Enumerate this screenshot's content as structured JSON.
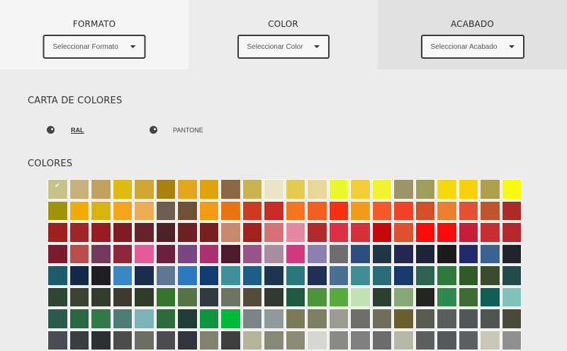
{
  "filters": [
    {
      "title": "FORMATO",
      "placeholder": "Seleccionar Formato"
    },
    {
      "title": "COLOR",
      "placeholder": "Seleccionar Color"
    },
    {
      "title": "ACABADO",
      "placeholder": "Seleccionar Acabado"
    }
  ],
  "color_chart": {
    "title": "CARTA DE COLORES",
    "options": [
      {
        "label": "RAL",
        "icon": "palette-icon",
        "selected": true
      },
      {
        "label": "PANTONE",
        "icon": "palette-icon",
        "selected": false
      }
    ]
  },
  "colors_section": {
    "title": "COLORES",
    "selected_index": 0,
    "swatches": [
      "#c7c18a",
      "#c8b07a",
      "#c4a060",
      "#e0b812",
      "#d2a635",
      "#a9820f",
      "#e4a51a",
      "#dea20c",
      "#8c6847",
      "#cbb553",
      "#eae5c7",
      "#e5ca50",
      "#e7d89a",
      "#ecf82a",
      "#f2cf38",
      "#f2f330",
      "#9e9568",
      "#9e9e5a",
      "#f5d90c",
      "#f8d009",
      "#aea04c",
      "#f8f90c",
      "#a19209",
      "#f2ac06",
      "#dbb30e",
      "#f5a41c",
      "#efaa55",
      "#6e5e52",
      "#6f5233",
      "#f39c12",
      "#ed7312",
      "#cc3a22",
      "#c92a26",
      "#f9731e",
      "#f35f21",
      "#fb2e11",
      "#f39c1a",
      "#f7572b",
      "#f24127",
      "#d44e28",
      "#ee7f2e",
      "#e65136",
      "#c2552f",
      "#ad2b27",
      "#a01f1f",
      "#a22527",
      "#9a1b1f",
      "#7f1c26",
      "#65232a",
      "#4e2226",
      "#6e2025",
      "#7a1e20",
      "#c58a6e",
      "#a2231d",
      "#d47278",
      "#e38aa0",
      "#b32a2d",
      "#de3042",
      "#d6303c",
      "#c7090d",
      "#de512f",
      "#fb0a0a",
      "#fc0a0a",
      "#c71e3c",
      "#ca2e33",
      "#b6262d",
      "#7b1c30",
      "#b84e49",
      "#74385c",
      "#8c283a",
      "#e45b9a",
      "#6d1f3f",
      "#7a4784",
      "#aa3271",
      "#4e1a2d",
      "#98558a",
      "#a88c9f",
      "#d23a80",
      "#8f7fb0",
      "#6f6d70",
      "#2e4e80",
      "#233643",
      "#232751",
      "#1f2536",
      "#1b1b1c",
      "#232b6e",
      "#3b6295",
      "#22242c",
      "#1e5c6c",
      "#15294a",
      "#211d25",
      "#3b86c1",
      "#1b2b4e",
      "#5e7893",
      "#2b7ac0",
      "#123b70",
      "#41909a",
      "#1c5e88",
      "#1e3652",
      "#28787c",
      "#1f2f55",
      "#4a6f95",
      "#3f8f94",
      "#296b76",
      "#163a69",
      "#2d6450",
      "#2c7a3c",
      "#305b29",
      "#3d4c2c",
      "#234b4e",
      "#2e4634",
      "#3e4434",
      "#333d2e",
      "#3d3b31",
      "#2f3a2b",
      "#33752c",
      "#557547",
      "#323b3f",
      "#6c7462",
      "#554d3a",
      "#333833",
      "#1f5a43",
      "#4c953c",
      "#55ac3b",
      "#bfe3b1",
      "#2d4130",
      "#86a877",
      "#262421",
      "#2d8b4e",
      "#3e6d31",
      "#0f5f56",
      "#7fc3bb",
      "#2c5a4b",
      "#286741",
      "#307a45",
      "#4d7e76",
      "#7cb3ba",
      "#2b6c39",
      "#203c36",
      "#0f933e",
      "#00b837",
      "#7b8589",
      "#8f989b",
      "#7d7a57",
      "#7c8166",
      "#9b9b92",
      "#6c6e68",
      "#6f6c5a",
      "#6a5f2e",
      "#565c52",
      "#59605b",
      "#51585a",
      "#4f5552",
      "#494a3a",
      "#4a4c56",
      "#383e41",
      "#2c3135",
      "#4b4c4c",
      "#6e6d63",
      "#4b4c54",
      "#303540",
      "#83816e",
      "#3d3f40",
      "#b5b39a",
      "#888876",
      "#8d8b74",
      "#d6d6d2",
      "#8a8a86",
      "#7d7f80",
      "#6a6c6b",
      "#b7b7a5",
      "#5b5f60",
      "#535a5e",
      "#5a5f64",
      "#cac6b6",
      "#8e9091"
    ]
  }
}
